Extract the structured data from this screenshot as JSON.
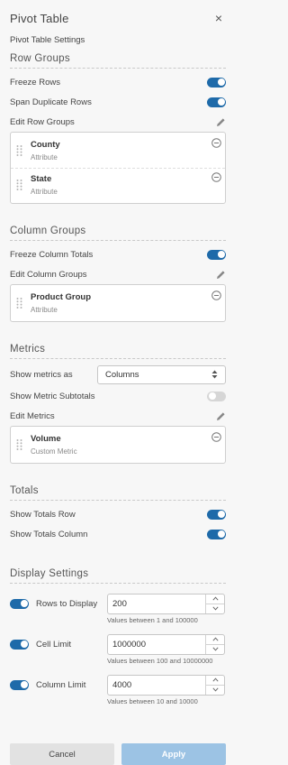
{
  "header": {
    "title": "Pivot Table",
    "close_label": "×",
    "settings_label": "Pivot Table Settings"
  },
  "row_groups": {
    "title": "Row Groups",
    "freeze_rows_label": "Freeze Rows",
    "freeze_rows_on": true,
    "span_duplicates_label": "Span Duplicate Rows",
    "span_duplicates_on": true,
    "edit_label": "Edit Row Groups",
    "items": [
      {
        "name": "County",
        "type": "Attribute"
      },
      {
        "name": "State",
        "type": "Attribute"
      }
    ]
  },
  "column_groups": {
    "title": "Column Groups",
    "freeze_totals_label": "Freeze Column Totals",
    "freeze_totals_on": true,
    "edit_label": "Edit Column Groups",
    "items": [
      {
        "name": "Product Group",
        "type": "Attribute"
      }
    ]
  },
  "metrics": {
    "title": "Metrics",
    "show_as_label": "Show metrics as",
    "show_as_value": "Columns",
    "subtotals_label": "Show Metric Subtotals",
    "subtotals_on": false,
    "edit_label": "Edit Metrics",
    "items": [
      {
        "name": "Volume",
        "type": "Custom Metric"
      }
    ]
  },
  "totals": {
    "title": "Totals",
    "show_row_label": "Show Totals Row",
    "show_row_on": true,
    "show_column_label": "Show Totals Column",
    "show_column_on": true
  },
  "display_settings": {
    "title": "Display Settings",
    "rows": [
      {
        "label": "Rows to Display",
        "value": "200",
        "hint": "Values between 1 and 100000",
        "enabled": true
      },
      {
        "label": "Cell Limit",
        "value": "1000000",
        "hint": "Values between 100 and 10000000",
        "enabled": true
      },
      {
        "label": "Column Limit",
        "value": "4000",
        "hint": "Values between 10 and 10000",
        "enabled": true
      }
    ]
  },
  "footer": {
    "cancel_label": "Cancel",
    "apply_label": "Apply"
  },
  "colors": {
    "accent": "#1e6aa9",
    "toggle_off": "#d6d6d6",
    "apply_bg": "#9cc3e4",
    "cancel_bg": "#e2e2e2"
  }
}
